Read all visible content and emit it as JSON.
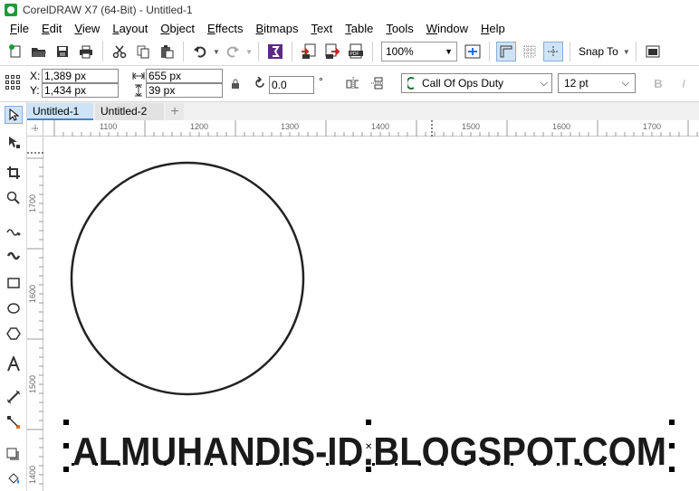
{
  "window": {
    "title": "CorelDRAW X7 (64-Bit) - Untitled-1"
  },
  "menu": [
    {
      "label": "File"
    },
    {
      "label": "Edit"
    },
    {
      "label": "View"
    },
    {
      "label": "Layout"
    },
    {
      "label": "Object"
    },
    {
      "label": "Effects"
    },
    {
      "label": "Bitmaps"
    },
    {
      "label": "Text"
    },
    {
      "label": "Table"
    },
    {
      "label": "Tools"
    },
    {
      "label": "Window"
    },
    {
      "label": "Help"
    }
  ],
  "toolbar": {
    "zoom_value": "100%",
    "snap_label": "Snap To"
  },
  "properties": {
    "x_label": "X:",
    "y_label": "Y:",
    "x_value": "1,389 px",
    "y_value": "1,434 px",
    "width_value": "655 px",
    "height_value": "39 px",
    "rotation_value": "0.0",
    "rotation_unit": "°",
    "font_name": "Call Of Ops Duty",
    "font_size": "12 pt"
  },
  "tabs": [
    {
      "label": "Untitled-1",
      "active": true
    },
    {
      "label": "Untitled-2",
      "active": false
    }
  ],
  "rulers": {
    "horizontal_labels": [
      "1100",
      "1200",
      "1300",
      "1400",
      "1500",
      "1600",
      "1700"
    ],
    "vertical_labels": [
      "1700",
      "1600",
      "1500",
      "1400"
    ]
  },
  "canvas": {
    "text_object": "ALMUHANDIS-ID.BLOGSPOT.COM"
  },
  "colors": {
    "accent": "#3a89d6",
    "tab_active_bg": "#cfe3f6",
    "canvas_bg": "#ffffff"
  }
}
